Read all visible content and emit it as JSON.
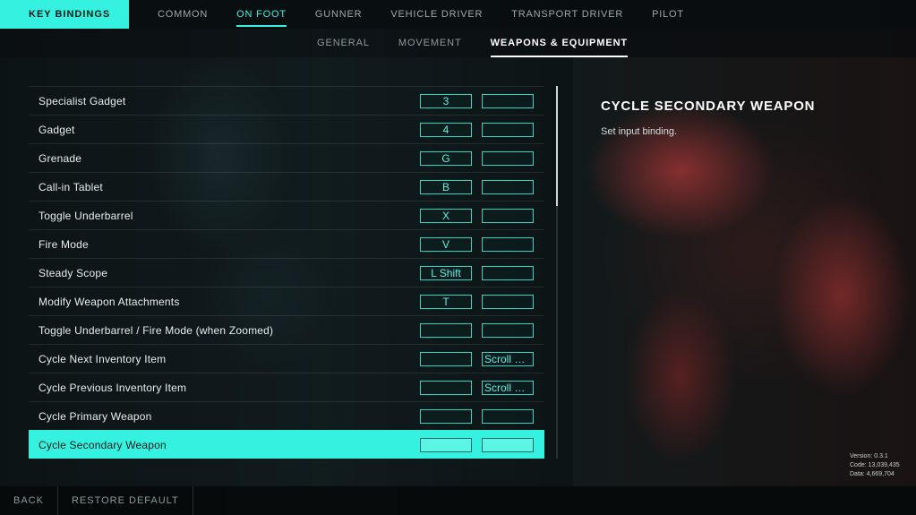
{
  "header": {
    "title": "KEY BINDINGS",
    "tabs": [
      {
        "label": "COMMON",
        "active": false
      },
      {
        "label": "ON FOOT",
        "active": true
      },
      {
        "label": "GUNNER",
        "active": false
      },
      {
        "label": "VEHICLE DRIVER",
        "active": false
      },
      {
        "label": "TRANSPORT DRIVER",
        "active": false
      },
      {
        "label": "PILOT",
        "active": false
      }
    ]
  },
  "subtabs": [
    {
      "label": "GENERAL",
      "active": false
    },
    {
      "label": "MOVEMENT",
      "active": false
    },
    {
      "label": "WEAPONS & EQUIPMENT",
      "active": true
    }
  ],
  "bindings": [
    {
      "label": "Specialist Gadget",
      "primary": "3",
      "secondary": ""
    },
    {
      "label": "Gadget",
      "primary": "4",
      "secondary": ""
    },
    {
      "label": "Grenade",
      "primary": "G",
      "secondary": ""
    },
    {
      "label": "Call-in Tablet",
      "primary": "B",
      "secondary": ""
    },
    {
      "label": "Toggle Underbarrel",
      "primary": "X",
      "secondary": ""
    },
    {
      "label": "Fire Mode",
      "primary": "V",
      "secondary": ""
    },
    {
      "label": "Steady Scope",
      "primary": "L Shift",
      "secondary": ""
    },
    {
      "label": "Modify Weapon Attachments",
      "primary": "T",
      "secondary": ""
    },
    {
      "label": "Toggle Underbarrel / Fire Mode (when Zoomed)",
      "primary": "",
      "secondary": ""
    },
    {
      "label": "Cycle Next Inventory Item",
      "primary": "",
      "secondary": "Scroll W..."
    },
    {
      "label": "Cycle Previous Inventory Item",
      "primary": "",
      "secondary": "Scroll W..."
    },
    {
      "label": "Cycle Primary Weapon",
      "primary": "",
      "secondary": ""
    },
    {
      "label": "Cycle Secondary Weapon",
      "primary": "",
      "secondary": "",
      "selected": true
    }
  ],
  "detail": {
    "title": "CYCLE SECONDARY WEAPON",
    "description": "Set input binding."
  },
  "version_info": {
    "version": "Version: 0.3.1",
    "code": "Code: 13,039,435",
    "data": "Data: 4,669,704"
  },
  "footer": {
    "back_label": "BACK",
    "restore_label": "RESTORE DEFAULT"
  },
  "colors": {
    "accent": "#34f2df",
    "text": "#e8eeee",
    "muted": "#9ea9aa"
  }
}
